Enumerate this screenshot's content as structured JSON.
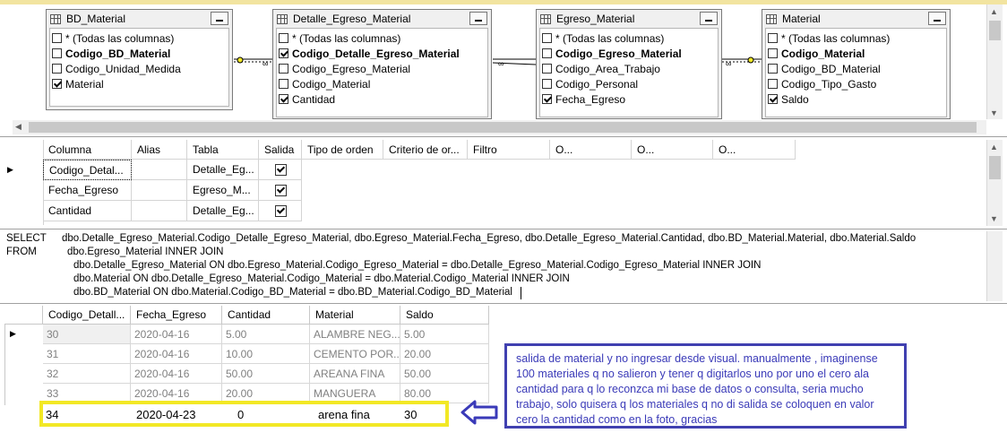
{
  "diagram": {
    "tables": [
      {
        "title": "BD_Material",
        "columns": [
          {
            "label": "* (Todas las columnas)",
            "checked": false,
            "bold": false
          },
          {
            "label": "Codigo_BD_Material",
            "checked": false,
            "bold": true
          },
          {
            "label": "Codigo_Unidad_Medida",
            "checked": false,
            "bold": false
          },
          {
            "label": "Material",
            "checked": true,
            "bold": false
          }
        ]
      },
      {
        "title": "Detalle_Egreso_Material",
        "columns": [
          {
            "label": "* (Todas las columnas)",
            "checked": false,
            "bold": false
          },
          {
            "label": "Codigo_Detalle_Egreso_Material",
            "checked": true,
            "bold": true
          },
          {
            "label": "Codigo_Egreso_Material",
            "checked": false,
            "bold": false
          },
          {
            "label": "Codigo_Material",
            "checked": false,
            "bold": false
          },
          {
            "label": "Cantidad",
            "checked": true,
            "bold": false
          }
        ]
      },
      {
        "title": "Egreso_Material",
        "columns": [
          {
            "label": "* (Todas las columnas)",
            "checked": false,
            "bold": false
          },
          {
            "label": "Codigo_Egreso_Material",
            "checked": false,
            "bold": true
          },
          {
            "label": "Codigo_Area_Trabajo",
            "checked": false,
            "bold": false
          },
          {
            "label": "Codigo_Personal",
            "checked": false,
            "bold": false
          },
          {
            "label": "Fecha_Egreso",
            "checked": true,
            "bold": false
          }
        ]
      },
      {
        "title": "Material",
        "columns": [
          {
            "label": "* (Todas las columnas)",
            "checked": false,
            "bold": false
          },
          {
            "label": "Codigo_Material",
            "checked": false,
            "bold": true
          },
          {
            "label": "Codigo_BD_Material",
            "checked": false,
            "bold": false
          },
          {
            "label": "Codigo_Tipo_Gasto",
            "checked": false,
            "bold": false
          },
          {
            "label": "Saldo",
            "checked": true,
            "bold": false
          }
        ]
      }
    ]
  },
  "criteria_grid": {
    "headers": [
      "Columna",
      "Alias",
      "Tabla",
      "Salida",
      "Tipo de orden",
      "Criterio de or...",
      "Filtro",
      "O...",
      "O...",
      "O..."
    ],
    "rows": [
      {
        "columna": "Codigo_Detal...",
        "alias": "",
        "tabla": "Detalle_Eg...",
        "salida": true
      },
      {
        "columna": "Fecha_Egreso",
        "alias": "",
        "tabla": "Egreso_M...",
        "salida": true
      },
      {
        "columna": "Cantidad",
        "alias": "",
        "tabla": "Detalle_Eg...",
        "salida": true
      }
    ]
  },
  "sql": {
    "keyword_select": "SELECT",
    "keyword_from": "FROM",
    "lines": [
      "dbo.Detalle_Egreso_Material.Codigo_Detalle_Egreso_Material, dbo.Egreso_Material.Fecha_Egreso, dbo.Detalle_Egreso_Material.Cantidad, dbo.BD_Material.Material, dbo.Material.Saldo",
      "dbo.Egreso_Material INNER JOIN",
      "dbo.Detalle_Egreso_Material ON dbo.Egreso_Material.Codigo_Egreso_Material = dbo.Detalle_Egreso_Material.Codigo_Egreso_Material INNER JOIN",
      "dbo.Material ON dbo.Detalle_Egreso_Material.Codigo_Material = dbo.Material.Codigo_Material INNER JOIN",
      "dbo.BD_Material ON dbo.Material.Codigo_BD_Material = dbo.BD_Material.Codigo_BD_Material"
    ]
  },
  "results": {
    "headers": [
      "Codigo_Detall...",
      "Fecha_Egreso",
      "Cantidad",
      "Material",
      "Saldo"
    ],
    "rows": [
      [
        "30",
        "2020-04-16",
        "5.00",
        "ALAMBRE NEG...",
        "5.00"
      ],
      [
        "31",
        "2020-04-16",
        "10.00",
        "CEMENTO POR...",
        "20.00"
      ],
      [
        "32",
        "2020-04-16",
        "50.00",
        "AREANA FINA",
        "50.00"
      ],
      [
        "33",
        "2020-04-16",
        "20.00",
        "MANGUERA",
        "80.00"
      ]
    ],
    "added_row": [
      "34",
      "2020-04-23",
      "0",
      "arena fina",
      "30"
    ]
  },
  "annotation": {
    "text": "salida de material y no ingresar desde visual. manualmente , imaginense 100 materiales q no salieron y tener q digitarlos uno por uno el cero ala cantidad para q lo reconzca mi base de datos o consulta, seria mucho trabajo, solo quisera q los materiales q no di salida se coloquen en valor cero la cantidad como en la foto, gracias",
    "border_color": "#4040b0",
    "highlight_color": "#f2e825"
  }
}
